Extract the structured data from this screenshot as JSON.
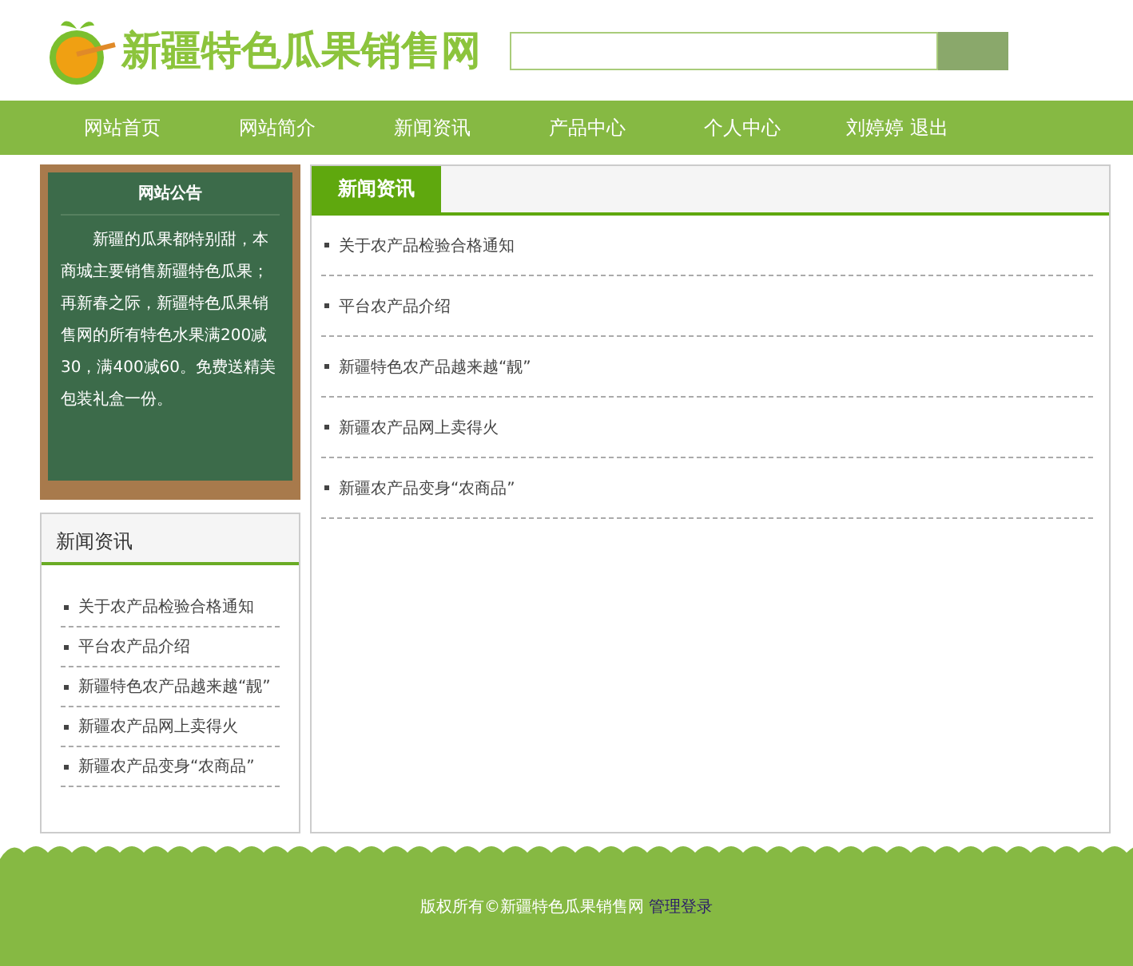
{
  "header": {
    "site_title": "新疆特色瓜果销售网"
  },
  "nav": {
    "items": [
      "网站首页",
      "网站简介",
      "新闻资讯",
      "产品中心",
      "个人中心"
    ],
    "user": "刘婷婷",
    "logout": "退出"
  },
  "notice_board": {
    "title": "网站公告",
    "paragraphs": [
      "新疆的瓜果都特别甜，本商城主要销售新疆特色瓜果；",
      "再新春之际，新疆特色瓜果销售网的所有特色水果满200减30，满400减60。免费送精美包装礼盒一份。"
    ]
  },
  "side_news": {
    "title": "新闻资讯",
    "items": [
      "关于农产品检验合格通知",
      "平台农产品介绍",
      "新疆特色农产品越来越“靓”",
      "新疆农产品网上卖得火",
      "新疆农产品变身“农商品”"
    ]
  },
  "main_news": {
    "tab": "新闻资讯",
    "items": [
      "关于农产品检验合格通知",
      "平台农产品介绍",
      "新疆特色农产品越来越“靓”",
      "新疆农产品网上卖得火",
      "新疆农产品变身“农商品”"
    ]
  },
  "footer": {
    "copyright": "版权所有©新疆特色瓜果销售网",
    "admin_link": "管理登录"
  }
}
